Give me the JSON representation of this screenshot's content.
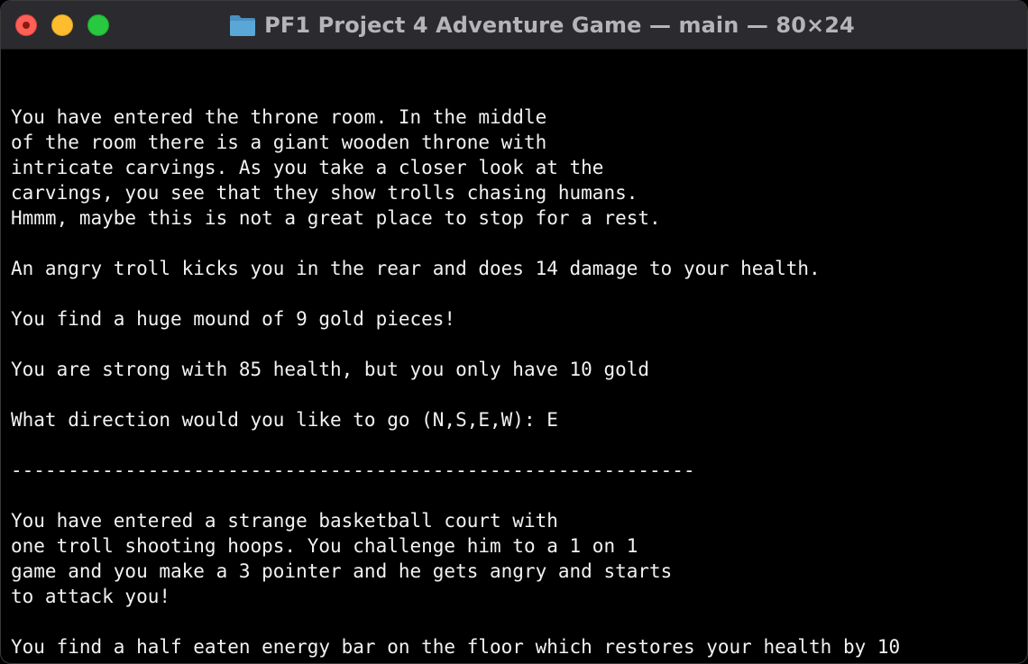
{
  "window": {
    "title": "PF1 Project 4 Adventure Game — main — 80×24",
    "title_icon": "folder-icon",
    "colors": {
      "titlebar": "#2b2a2f",
      "background": "#000000",
      "text": "#f2f2f2",
      "title_text": "#b5b5b8",
      "close": "#fe5f57",
      "minimize": "#febc2e",
      "zoom": "#28c840",
      "folder": "#5aa6d6"
    }
  },
  "terminal": {
    "lines": [
      "",
      "You have entered the throne room. In the middle",
      "of the room there is a giant wooden throne with",
      "intricate carvings. As you take a closer look at the",
      "carvings, you see that they show trolls chasing humans.",
      "Hmmm, maybe this is not a great place to stop for a rest.",
      "",
      "An angry troll kicks you in the rear and does 14 damage to your health.",
      "",
      "You find a huge mound of 9 gold pieces!",
      "",
      "You are strong with 85 health, but you only have 10 gold",
      "",
      "What direction would you like to go (N,S,E,W): E",
      "",
      "------------------------------------------------------------",
      "",
      "You have entered a strange basketball court with",
      "one troll shooting hoops. You challenge him to a 1 on 1",
      "game and you make a 3 pointer and he gets angry and starts",
      "to attack you!",
      "",
      "You find a half eaten energy bar on the floor which restores your health by 10"
    ]
  }
}
